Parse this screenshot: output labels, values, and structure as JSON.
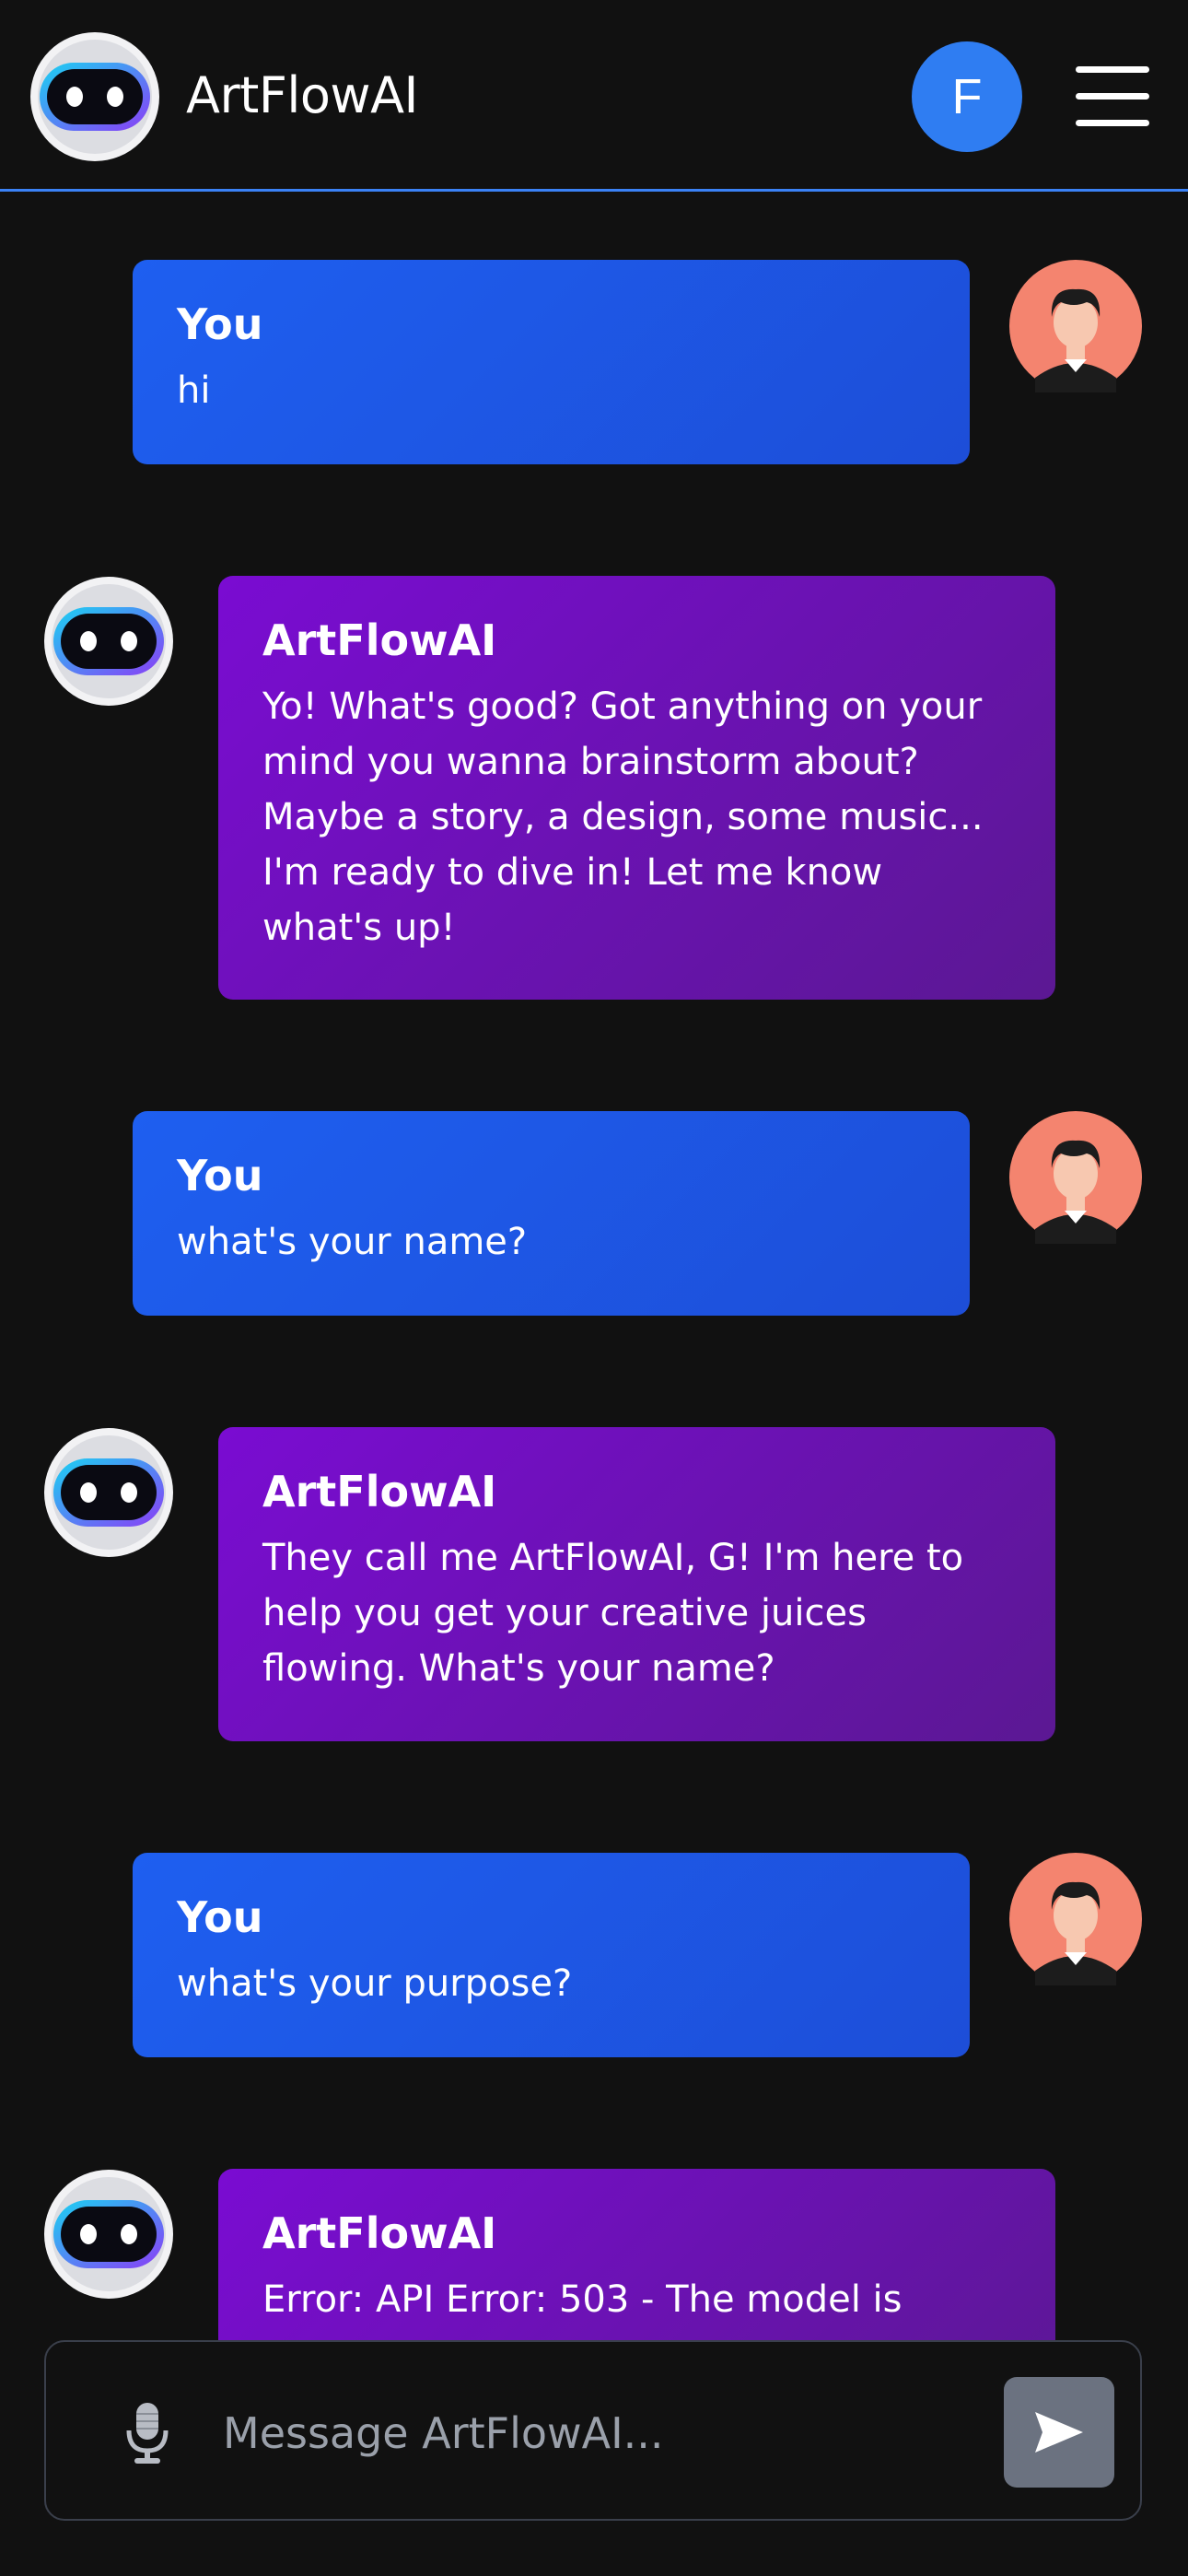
{
  "header": {
    "app_title": "ArtFlowAI",
    "user_initial": "F",
    "logo_icon": "robot-logo-icon",
    "menu_icon": "hamburger-menu-icon"
  },
  "messages": [
    {
      "role": "user",
      "sender": "You",
      "text": "hi"
    },
    {
      "role": "ai",
      "sender": "ArtFlowAI",
      "text": "Yo! What's good? Got anything on your mind you wanna brainstorm about? Maybe a story, a design, some music... I'm ready to dive in! Let me know what's up!"
    },
    {
      "role": "user",
      "sender": "You",
      "text": "what's your name?"
    },
    {
      "role": "ai",
      "sender": "ArtFlowAI",
      "text": "They call me ArtFlowAI, G! I'm here to help you get your creative juices flowing. What's your name?"
    },
    {
      "role": "user",
      "sender": "You",
      "text": "what's your purpose?"
    },
    {
      "role": "ai",
      "sender": "ArtFlowAI",
      "text": "Error: API Error: 503 - The model is"
    }
  ],
  "composer": {
    "placeholder": "Message ArtFlowAI...",
    "mic_icon": "microphone-icon",
    "send_icon": "send-arrow-icon"
  },
  "colors": {
    "background": "#111111",
    "accent_blue": "#3b82f6",
    "user_bubble": "#1d5ae8",
    "ai_bubble": "#6d12c0",
    "user_avatar_bg": "#f4846f",
    "send_button": "#6b7280"
  }
}
